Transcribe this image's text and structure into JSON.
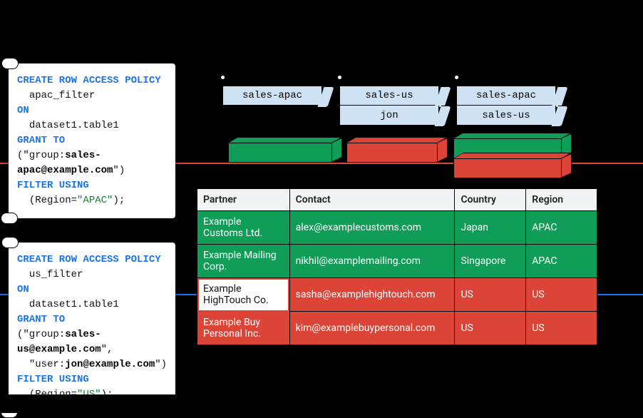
{
  "policies": {
    "apac": {
      "line1_kw": "CREATE ROW ACCESS POLICY",
      "name": "apac_filter",
      "on_kw": "ON",
      "target": "dataset1.table1",
      "grant_kw": "GRANT TO",
      "grant_open": "(\"group:",
      "grant_principal": "sales-apac@example.com",
      "grant_close": "\")",
      "filter_kw": "FILTER USING",
      "filter_expr_open": "(Region=",
      "filter_value": "\"APAC\"",
      "filter_expr_close": ");"
    },
    "us": {
      "line1_kw": "CREATE ROW ACCESS POLICY",
      "name": "us_filter",
      "on_kw": "ON",
      "target": "dataset1.table1",
      "grant_kw": "GRANT TO",
      "grant_open": "(\"group:",
      "grant_principal": "sales-us@example.com",
      "grant_mid": "\",",
      "grant2_open": "\"user:",
      "grant2_principal": "jon@example.com",
      "grant2_close": "\")",
      "filter_kw": "FILTER USING",
      "filter_expr_open": "(Region=",
      "filter_value": "\"US\"",
      "filter_expr_close": ");"
    }
  },
  "flags": {
    "col1": [
      "sales-apac"
    ],
    "col2": [
      "sales-us",
      "jon"
    ],
    "col3": [
      "sales-apac",
      "sales-us"
    ]
  },
  "table": {
    "headers": [
      "Partner",
      "Contact",
      "Country",
      "Region"
    ],
    "rows": [
      {
        "partner": "Example Customs Ltd.",
        "contact": "alex@examplecustoms.com",
        "country": "Japan",
        "region": "APAC",
        "color": "green"
      },
      {
        "partner": "Example Mailing Corp.",
        "contact": "nikhil@examplemailing.com",
        "country": "Singapore",
        "region": "APAC",
        "color": "green"
      },
      {
        "partner": "Example HighTouch Co.",
        "contact": "sasha@examplehightouch.com",
        "country": "US",
        "region": "US",
        "color": "red",
        "white_first": true
      },
      {
        "partner": "Example Buy Personal Inc.",
        "contact": "kim@examplebuypersonal.com",
        "country": "US",
        "region": "US",
        "color": "red"
      }
    ]
  }
}
